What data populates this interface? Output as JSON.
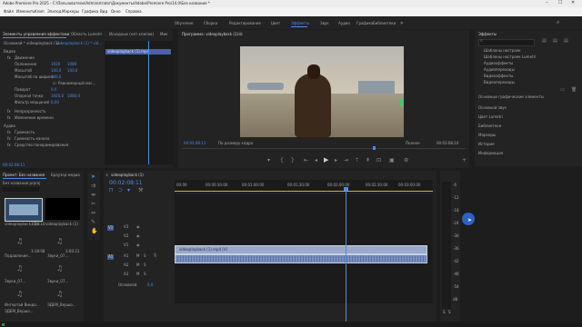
{
  "window": {
    "title": "Adobe Premiere Pro 2025 - C:\\Пользователи\\Administrator\\Документы\\Adobe\\Premiere Pro\\14.0\\Без названия *"
  },
  "menu": [
    "Файл",
    "Изменить",
    "Клип",
    "Эпизод",
    "Маркеры",
    "Графика",
    "Вид",
    "Окно",
    "Справка"
  ],
  "workspaces": [
    "Обучение",
    "Сборка",
    "Редактирование",
    "Цвет",
    "Эффекты",
    "Звук",
    "Аудио",
    "Графика",
    "Библиотеки"
  ],
  "workspace_active_index": 4,
  "effect_controls": {
    "tabs": [
      "Элементы управления эффектами",
      "Область Lumetri",
      "Исходные (нет клипов)",
      "Мик"
    ],
    "source": "Основной * videoplayback (1)...",
    "sequence": "videoplayback (1) * vid...",
    "section_video": "Видео",
    "motion": "Движение",
    "rows": [
      {
        "label": "Положение",
        "v1": "1920",
        "v2": "1080"
      },
      {
        "label": "Масштаб",
        "v1": "100,0",
        "v2": "100,0"
      },
      {
        "label": "Масштаб по ширине",
        "v1": "100,0",
        "v2": ""
      },
      {
        "label": "",
        "v1": "",
        "v2": ""
      },
      {
        "label": "Поворот",
        "v1": "0,0",
        "v2": ""
      },
      {
        "label": "Опорная точка",
        "v1": "1920,0",
        "v2": "1080,0"
      },
      {
        "label": "Фильтр мерцаний",
        "v1": "0,00",
        "v2": ""
      }
    ],
    "uniform_scale": "Равномерный мас...",
    "opacity": "Непрозрачность",
    "time_remap": "Изменение времени",
    "section_audio": "Аудио",
    "audio_rows": [
      "Громкость",
      "Громкость канала",
      "Средство панорамирования"
    ],
    "timecode": "00:02:08:11",
    "clip_bar": "videoplayback (1).mp4"
  },
  "program_monitor": {
    "title": "Программа: videoplayback (1)",
    "timecode": "00:02:08:11",
    "fit": "По размеру кадра",
    "quality": "Полное",
    "duration": "00:03:08:10"
  },
  "effects_panel": {
    "title": "Эффекты",
    "tree": [
      "Шаблоны настроек",
      "Шаблоны настроек Lumetri",
      "Аудиоэффекты",
      "Аудиопереходы",
      "Видеоэффекты",
      "Видеопереходы"
    ],
    "groups": [
      "Основные графические элементы",
      "Основной звук",
      "Цвет Lumetri",
      "Библиотеки",
      "Маркеры",
      "История",
      "Информация"
    ]
  },
  "project": {
    "tabs": [
      "Проект: Без названия",
      "Браузер медиа"
    ],
    "filename": "Без названия.prproj",
    "items": [
      {
        "name": "videoplayback (1)...",
        "dur": "3:08:10"
      },
      {
        "name": "videoplayback (1)",
        "dur": "3:08:10"
      },
      {
        "name": "Подавление...",
        "dur": "3:18:08"
      },
      {
        "name": "Звуки_07...",
        "dur": "3:00:21"
      },
      {
        "name": "Звуки_07...",
        "dur": "3:00:25"
      },
      {
        "name": "Звуки_07...",
        "dur": "3:00:25"
      },
      {
        "name": "Интертай Виндо...",
        "dur": "3:00:25"
      },
      {
        "name": "ЭДЕМ_Вершо...",
        "dur": "3:00:25"
      },
      {
        "name": "ЭДЕМ_Вершо...",
        "dur": "3:00:25"
      }
    ]
  },
  "timeline": {
    "tab": "videoplayback (1)",
    "timecode": "00:02:08:11",
    "ruler": [
      "00:00",
      "00:00:30:00",
      "00:01:00:00",
      "00:01:30:00",
      "00:02:00:00",
      "00:02:30:00",
      "00:03:00:00"
    ],
    "tracks_video": [
      "V3",
      "V2",
      "V1"
    ],
    "tracks_audio": [
      "A1",
      "A2",
      "A3"
    ],
    "master": "Основной",
    "master_value": "0,0",
    "clip_video": "videoplayback (1).mp4 [V]",
    "playhead_fraction": 0.67
  },
  "meter": {
    "scale": [
      "-6",
      "-12",
      "-18",
      "-24",
      "-30",
      "-36",
      "-42",
      "-48",
      "-54",
      "dB"
    ],
    "labels": [
      "S",
      "S"
    ]
  },
  "colors": {
    "accent": "#4b8de8",
    "clip_video": "#9aa8c9",
    "clip_audio": "#7a8fbf",
    "playhead": "#4b8de8"
  }
}
